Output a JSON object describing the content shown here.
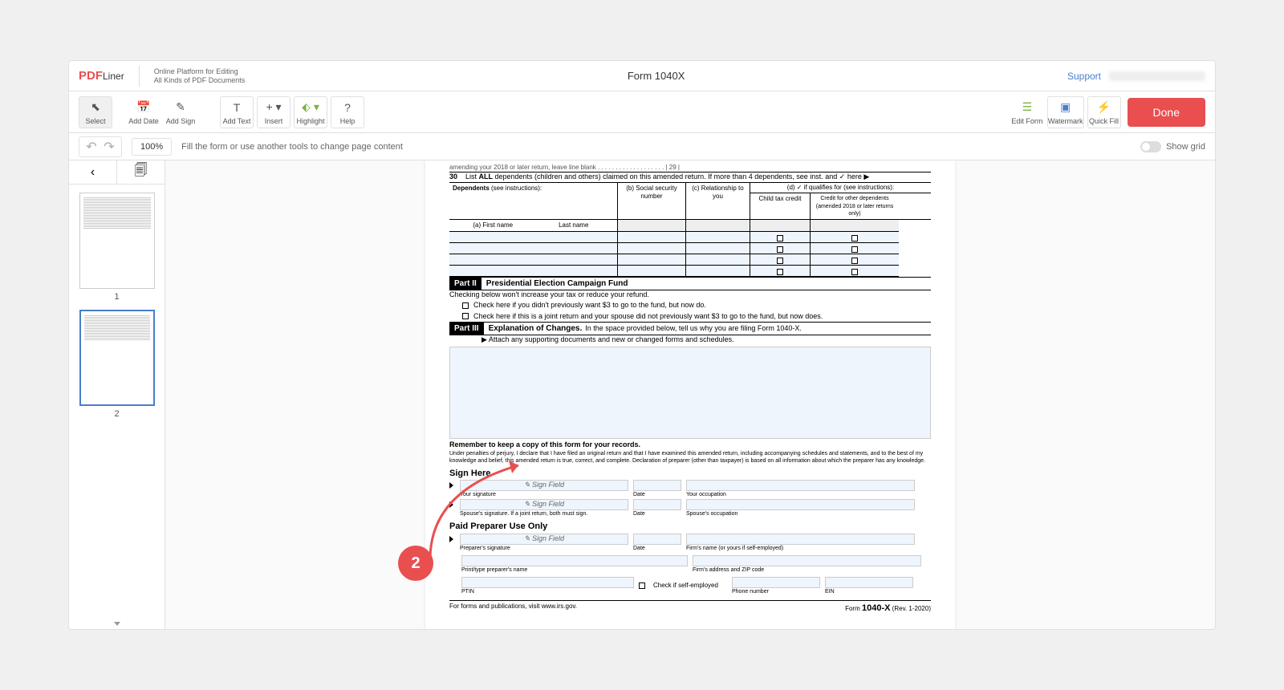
{
  "header": {
    "logo_main": "PDF",
    "logo_sub": "Liner",
    "logo_desc": "Online Platform for Editing\nAll Kinds of PDF Documents",
    "doc_title": "Form 1040X",
    "support": "Support"
  },
  "toolbar": {
    "select": "Select",
    "add_date": "Add Date",
    "add_sign": "Add Sign",
    "add_text": "Add Text",
    "insert": "Insert",
    "highlight": "Highlight",
    "help": "Help",
    "edit_form": "Edit Form",
    "watermark": "Watermark",
    "quick_fill": "Quick Fill",
    "done": "Done"
  },
  "subbar": {
    "zoom": "100%",
    "hint": "Fill the form or use another tools to change page content",
    "show_grid": "Show grid"
  },
  "thumbs": {
    "page1": "1",
    "page2": "2"
  },
  "form": {
    "line30_num": "30",
    "line30_a": "List ",
    "line30_b": "ALL",
    "line30_c": " dependents (children and others) claimed on this amended return. If more than 4 dependents, see inst. and ✓ here ▶",
    "dependents": "Dependents",
    "dep_see": " (see instructions):",
    "col_a": "(a) First name",
    "col_a2": "Last name",
    "col_b": "(b) Social security number",
    "col_c": "(c) Relationship to you",
    "col_d": "(d) ✓ if qualifies for (see instructions):",
    "col_d1": "Child tax credit",
    "col_d2": "Credit for other dependents (amended 2018 or later returns only)",
    "part2": "Part II",
    "part2_title": "Presidential Election Campaign Fund",
    "part2_line1": "Checking below won't increase your tax or reduce your refund.",
    "part2_chk1": "Check here if you didn't previously want $3 to go to the fund, but now do.",
    "part2_chk2": "Check here if this is a joint return and your spouse did not previously want $3 to go to the fund, but now does.",
    "part3": "Part III",
    "part3_title": "Explanation of Changes.",
    "part3_sub": " In the space provided below, tell us why you are filing Form 1040-X.",
    "part3_attach": "▶ Attach any supporting documents and new or changed forms and schedules.",
    "remember": "Remember to keep a copy of this form for your records.",
    "perjury": "Under penalties of perjury, I declare that I have filed an original return and that I have examined this amended return, including accompanying schedules and statements, and to the best of my knowledge and belief, this amended return is true, correct, and complete. Declaration of preparer (other than taxpayer) is based on all information about which the preparer has any knowledge.",
    "sign_here": "Sign Here",
    "sign_field": "✎ Sign Field",
    "your_sig": "Your signature",
    "date": "Date",
    "your_occ": "Your occupation",
    "spouse_sig": "Spouse's signature. If a joint return, both must sign.",
    "spouse_occ": "Spouse's occupation",
    "paid_prep": "Paid Preparer Use Only",
    "prep_sig": "Preparer's signature",
    "firm_name": "Firm's name (or yours if self-employed)",
    "print_prep": "Print/type preparer's name",
    "firm_addr": "Firm's address and ZIP code",
    "chk_self": "Check if self-employed",
    "ptin": "PTIN",
    "phone": "Phone number",
    "ein": "EIN",
    "bottom_left": "For forms and publications, visit www.irs.gov.",
    "bottom_right_a": "Form ",
    "bottom_right_b": "1040-X",
    "bottom_right_c": " (Rev. 1-2020)"
  },
  "annotation": {
    "badge": "2"
  }
}
